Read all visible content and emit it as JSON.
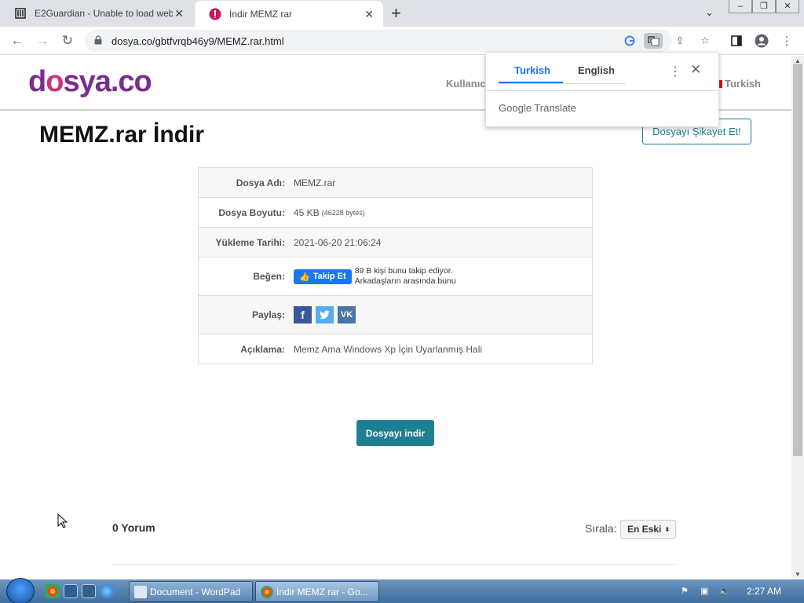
{
  "browser": {
    "tabs": [
      {
        "title": "E2Guardian - Unable to load web",
        "active": false
      },
      {
        "title": "İndir MEMZ rar",
        "active": true
      }
    ],
    "url": "dosya.co/gbtfvrqb46y9/MEMZ.rar.html"
  },
  "site": {
    "logo": {
      "part1": "d",
      "part2": "o",
      "part3": "sya.co"
    },
    "nav_user": "Kullanıc",
    "nav_lang": "Turkish"
  },
  "page": {
    "title": "MEMZ.rar İndir",
    "report_button": "Dosyayı Şikayet Et!",
    "info": {
      "file_name_label": "Dosya Adı:",
      "file_name": "MEMZ.rar",
      "size_label": "Dosya Boyutu:",
      "size": "45 KB",
      "size_bytes": "(46228 bytes)",
      "date_label": "Yükleme Tarihi:",
      "date": "2021-06-20 21:06:24",
      "like_label": "Beğen:",
      "follow_button": "Takip Et",
      "follow_line1": "89 B kişi bunu takip ediyor.",
      "follow_line2": "Arkadaşların arasında bunu",
      "share_label": "Paylaş:",
      "desc_label": "Açıklama:",
      "desc": "Memz Ama Windows Xp İçin Uyarlanmış Hali"
    },
    "download_button": "Dosyayı indir",
    "comments": "0 Yorum",
    "sort_label": "Sırala:",
    "sort_value": "En Eski"
  },
  "translate_popup": {
    "tab_source": "Turkish",
    "tab_target": "English",
    "brand": "Google Translate"
  },
  "taskbar": {
    "tasks": [
      {
        "label": "Document - WordPad"
      },
      {
        "label": "İndir MEMZ rar - Go..."
      }
    ],
    "clock": "2:27 AM"
  },
  "colors": {
    "accent": "#1e7f92",
    "logo_purple": "#7b2d8e",
    "translate_blue": "#1a73e8",
    "facebook": "#1877f2"
  }
}
